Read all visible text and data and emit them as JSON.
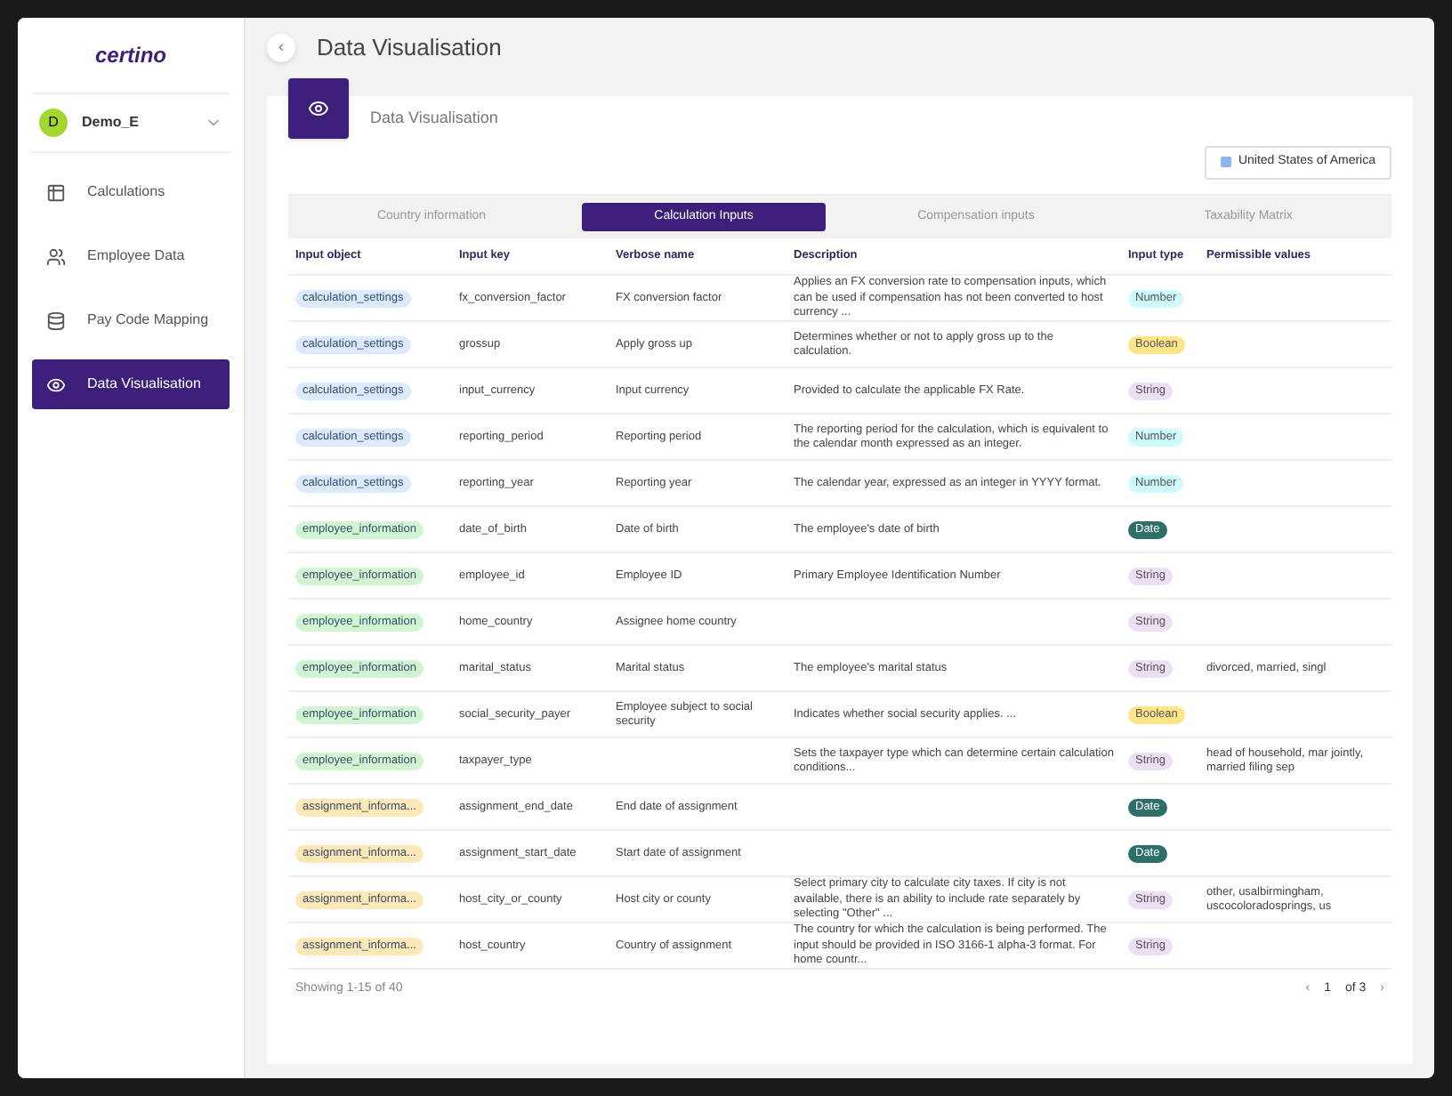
{
  "sidebar": {
    "logo": "certino",
    "account": {
      "initial": "D",
      "name": "Demo_E"
    },
    "items": [
      {
        "label": "Calculations",
        "kind": "table",
        "selected": false
      },
      {
        "label": "Employee Data",
        "kind": "users",
        "selected": false
      },
      {
        "label": "Pay Code Mapping",
        "kind": "database",
        "selected": false
      },
      {
        "label": "Data Visualisation",
        "kind": "eye",
        "selected": true
      }
    ]
  },
  "header": {
    "collapse": "‹",
    "title": "Data Visualisation"
  },
  "card": {
    "title": "Data Visualisation",
    "country": "United States of America"
  },
  "tabs": [
    {
      "label": "Country information",
      "selected": false
    },
    {
      "label": "Calculation Inputs",
      "selected": true
    },
    {
      "label": "Compensation inputs",
      "selected": false
    },
    {
      "label": "Taxability Matrix",
      "selected": false
    }
  ],
  "table": {
    "columns": [
      "Input object",
      "Input key",
      "Verbose name",
      "Description",
      "Input type",
      "Permissible values"
    ],
    "rows": [
      {
        "object": {
          "text": "calculation_settings",
          "color": "#dbeafe"
        },
        "key": "fx_conversion_factor",
        "verbose": "FX conversion factor",
        "description": "Applies an FX conversion rate to compensation inputs, which can be used if compensation has not been converted to host currency ...",
        "type": {
          "text": "Number",
          "color": "#cffafe"
        }
      },
      {
        "object": {
          "text": "calculation_settings",
          "color": "#dbeafe"
        },
        "key": "grossup",
        "verbose": "Apply gross up",
        "description": "Determines whether or not to apply gross up to the calculation.",
        "type": {
          "text": "Boolean",
          "color": "#fde68a"
        }
      },
      {
        "object": {
          "text": "calculation_settings",
          "color": "#dbeafe"
        },
        "key": "input_currency",
        "verbose": "Input currency",
        "description": "Provided to calculate the applicable FX Rate.",
        "type": {
          "text": "String",
          "color": "#ede0f5"
        }
      },
      {
        "object": {
          "text": "calculation_settings",
          "color": "#dbeafe"
        },
        "key": "reporting_period",
        "verbose": "Reporting period",
        "description": "The reporting period for the calculation, which is equivalent to the calendar month expressed as an integer.",
        "type": {
          "text": "Number",
          "color": "#cffafe"
        }
      },
      {
        "object": {
          "text": "calculation_settings",
          "color": "#dbeafe"
        },
        "key": "reporting_year",
        "verbose": "Reporting year",
        "description": "The calendar year, expressed as an integer in YYYY format.",
        "type": {
          "text": "Number",
          "color": "#cffafe"
        }
      },
      {
        "object": {
          "text": "employee_information",
          "color": "#d1f5d3"
        },
        "key": "date_of_birth",
        "verbose": "Date of birth",
        "description": "The employee's date of birth",
        "type": {
          "text": "Date",
          "color": "#2f6f6a"
        }
      },
      {
        "object": {
          "text": "employee_information",
          "color": "#d1f5d3"
        },
        "key": "employee_id",
        "verbose": "Employee ID",
        "description": "Primary Employee Identification Number",
        "type": {
          "text": "String",
          "color": "#ede0f5"
        }
      },
      {
        "object": {
          "text": "employee_information",
          "color": "#d1f5d3"
        },
        "key": "home_country",
        "verbose": "Assignee home country",
        "type": {
          "text": "String",
          "color": "#ede0f5"
        }
      },
      {
        "object": {
          "text": "employee_information",
          "color": "#d1f5d3"
        },
        "key": "marital_status",
        "verbose": "Marital status",
        "description": "The employee's marital status",
        "type": {
          "text": "String",
          "color": "#ede0f5"
        },
        "permissible": "divorced, married, singl"
      },
      {
        "object": {
          "text": "employee_information",
          "color": "#d1f5d3"
        },
        "key": "social_security_payer",
        "verbose": "Employee subject to social security",
        "description": "Indicates whether social security applies. ...",
        "type": {
          "text": "Boolean",
          "color": "#fde68a"
        }
      },
      {
        "object": {
          "text": "employee_information",
          "color": "#d1f5d3"
        },
        "key": "taxpayer_type",
        "description": "Sets the taxpayer type which can determine certain calculation conditions...",
        "type": {
          "text": "String",
          "color": "#ede0f5"
        },
        "permissible": "head of household, mar jointly, married filing sep"
      },
      {
        "object": {
          "text": "assignment_informa...",
          "color": "#fde9b8"
        },
        "key": "assignment_end_date",
        "verbose": "End date of assignment",
        "type": {
          "text": "Date",
          "color": "#2f6f6a"
        }
      },
      {
        "object": {
          "text": "assignment_informa...",
          "color": "#fde9b8"
        },
        "key": "assignment_start_date",
        "verbose": "Start date of assignment",
        "type": {
          "text": "Date",
          "color": "#2f6f6a"
        }
      },
      {
        "object": {
          "text": "assignment_informa...",
          "color": "#fde9b8"
        },
        "key": "host_city_or_county",
        "verbose": "Host city or county",
        "description": "Select primary city to calculate city taxes. If city is not available, there is an ability to include rate separately by selecting \"Other\" ...",
        "type": {
          "text": "String",
          "color": "#ede0f5"
        },
        "permissible": "other, usalbirmingham, uscocoloradosprings, us"
      },
      {
        "object": {
          "text": "assignment_informa...",
          "color": "#fde9b8"
        },
        "key": "host_country",
        "verbose": "Country of assignment",
        "description": "The country for which the calculation is being performed. The input should be provided in ISO 3166-1 alpha-3 format. For home countr...",
        "type": {
          "text": "String",
          "color": "#ede0f5"
        }
      }
    ]
  },
  "footer": {
    "showing": "Showing 1-15 of 40",
    "prev": "‹",
    "page": "1",
    "of": "of 3",
    "next": "›"
  }
}
